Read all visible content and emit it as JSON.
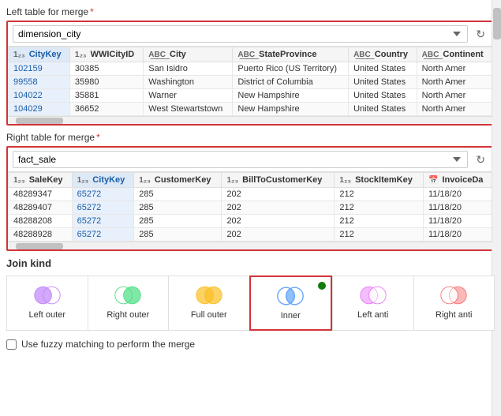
{
  "leftTable": {
    "sectionLabel": "Left table for merge",
    "required": true,
    "selectedValue": "dimension_city",
    "columns": [
      {
        "icon": "123",
        "name": "CityKey",
        "highlighted": true
      },
      {
        "icon": "123",
        "name": "WWICityID",
        "highlighted": false
      },
      {
        "icon": "abc",
        "name": "City",
        "highlighted": false
      },
      {
        "icon": "abc",
        "name": "StateProvince",
        "highlighted": false
      },
      {
        "icon": "abc",
        "name": "Country",
        "highlighted": false
      },
      {
        "icon": "abc",
        "name": "Continent",
        "highlighted": false
      }
    ],
    "rows": [
      [
        "102159",
        "30385",
        "San Isidro",
        "Puerto Rico (US Territory)",
        "United States",
        "North Amer"
      ],
      [
        "99558",
        "35980",
        "Washington",
        "District of Columbia",
        "United States",
        "North Amer"
      ],
      [
        "104022",
        "35881",
        "Warner",
        "New Hampshire",
        "United States",
        "North Amer"
      ],
      [
        "104029",
        "36652",
        "West Stewartstown",
        "New Hampshire",
        "United States",
        "North Amer"
      ]
    ]
  },
  "rightTable": {
    "sectionLabel": "Right table for merge",
    "required": true,
    "selectedValue": "fact_sale",
    "columns": [
      {
        "icon": "123",
        "name": "SaleKey",
        "highlighted": false
      },
      {
        "icon": "123",
        "name": "CityKey",
        "highlighted": true
      },
      {
        "icon": "123",
        "name": "CustomerKey",
        "highlighted": false
      },
      {
        "icon": "123",
        "name": "BillToCustomerKey",
        "highlighted": false
      },
      {
        "icon": "123",
        "name": "StockItemKey",
        "highlighted": false
      },
      {
        "icon": "cal",
        "name": "InvoiceDa",
        "highlighted": false
      }
    ],
    "rows": [
      [
        "48289347",
        "65272",
        "285",
        "202",
        "212",
        "11/18/20"
      ],
      [
        "48289407",
        "65272",
        "285",
        "202",
        "212",
        "11/18/20"
      ],
      [
        "48288208",
        "65272",
        "285",
        "202",
        "212",
        "11/18/20"
      ],
      [
        "48288928",
        "65272",
        "285",
        "202",
        "212",
        "11/18/20"
      ]
    ]
  },
  "joinKind": {
    "label": "Join kind",
    "options": [
      {
        "id": "left-outer",
        "label": "Left outer",
        "selected": false
      },
      {
        "id": "right-outer",
        "label": "Right\nouter",
        "selected": false
      },
      {
        "id": "full-outer",
        "label": "Full outer",
        "selected": false
      },
      {
        "id": "inner",
        "label": "Inner",
        "selected": true
      },
      {
        "id": "left-anti",
        "label": "Left anti",
        "selected": false
      },
      {
        "id": "right-anti",
        "label": "Right anti",
        "selected": false
      }
    ]
  },
  "fuzzyMatch": {
    "label": "Use fuzzy matching to perform the merge"
  },
  "scrollbar": {
    "visible": true
  }
}
